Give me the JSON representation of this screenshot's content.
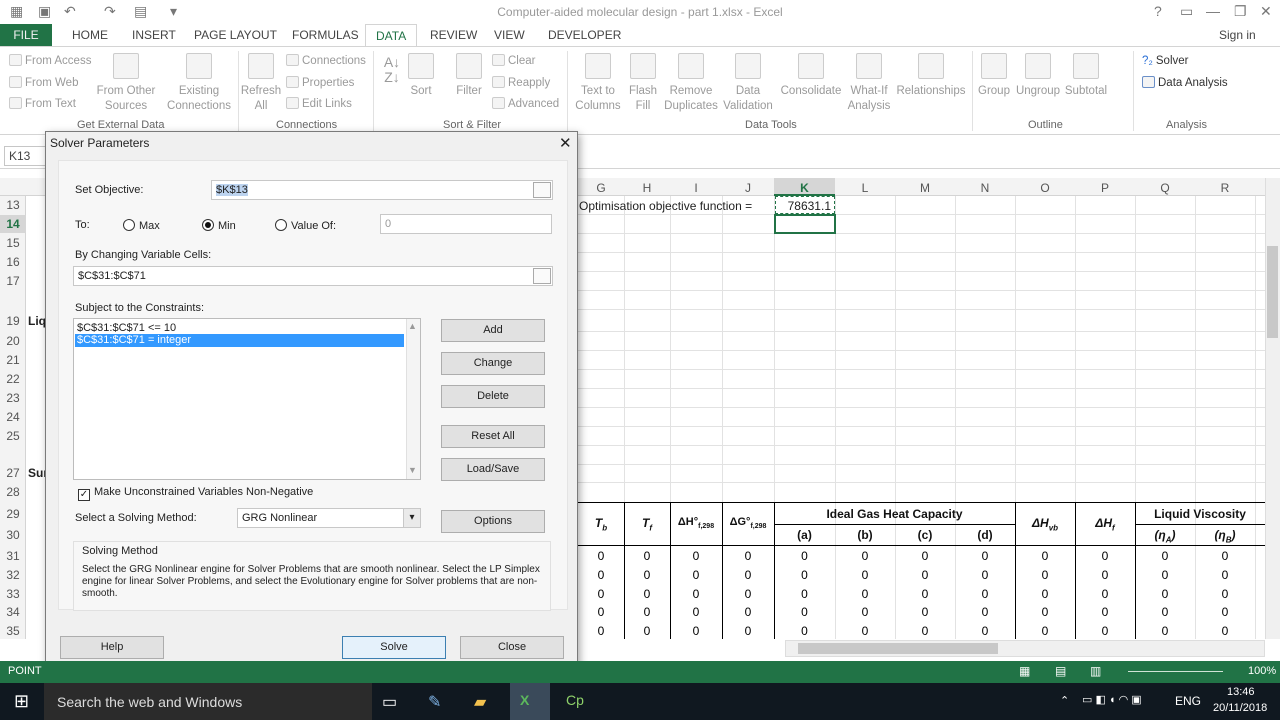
{
  "window": {
    "title": "Computer-aided molecular design - part 1.xlsx - Excel",
    "help": "?",
    "signin": "Sign in"
  },
  "tabs": [
    "FILE",
    "HOME",
    "INSERT",
    "PAGE LAYOUT",
    "FORMULAS",
    "DATA",
    "REVIEW",
    "VIEW",
    "DEVELOPER"
  ],
  "ribbon": {
    "get_external": {
      "from_access": "From Access",
      "from_web": "From Web",
      "from_text": "From Text",
      "from_other1": "From Other",
      "from_other2": "Sources",
      "existing1": "Existing",
      "existing2": "Connections",
      "group": "Get External Data"
    },
    "connections": {
      "refresh1": "Refresh",
      "refresh2": "All",
      "connections": "Connections",
      "properties": "Properties",
      "edit_links": "Edit Links",
      "group": "Connections"
    },
    "sort_filter": {
      "sort": "Sort",
      "filter": "Filter",
      "clear": "Clear",
      "reapply": "Reapply",
      "advanced": "Advanced",
      "group": "Sort & Filter"
    },
    "data_tools": {
      "t2c1": "Text to",
      "t2c2": "Columns",
      "flash1": "Flash",
      "flash2": "Fill",
      "remdup1": "Remove",
      "remdup2": "Duplicates",
      "dv1": "Data",
      "dv2": "Validation",
      "consolidate": "Consolidate",
      "whatif1": "What-If",
      "whatif2": "Analysis",
      "relationships": "Relationships",
      "group": "Data Tools"
    },
    "outline": {
      "group_btn": "Group",
      "ungroup": "Ungroup",
      "subtotal": "Subtotal",
      "group": "Outline"
    },
    "analysis": {
      "solver": "Solver",
      "data_analysis": "Data Analysis",
      "group": "Analysis"
    }
  },
  "namebox": "K13",
  "columns": [
    "G",
    "H",
    "I",
    "J",
    "K",
    "L",
    "M",
    "N",
    "O",
    "P",
    "Q",
    "R"
  ],
  "rows": [
    "13",
    "14",
    "15",
    "16",
    "17",
    "19",
    "20",
    "21",
    "22",
    "23",
    "24",
    "25",
    "27",
    "28",
    "29",
    "30",
    "31",
    "32",
    "33",
    "34",
    "35"
  ],
  "sheet": {
    "label_a19": "Liq",
    "label_a27": "Sur",
    "objective_label": "Optimisation objective function =",
    "objective_value": "78631.1",
    "hdr_tb": "T",
    "hdr_tb_sub": "b",
    "hdr_tf": "T",
    "hdr_tf_sub": "f",
    "hdr_dh": "ΔH°",
    "hdr_dh_sub": "f,298",
    "hdr_dg": "ΔG°",
    "hdr_dg_sub": "f,298",
    "hdr_igc": "Ideal Gas Heat Capacity",
    "hdr_a": "(a)",
    "hdr_b": "(b)",
    "hdr_c": "(c)",
    "hdr_d": "(d)",
    "hdr_dhvb": "ΔH",
    "hdr_dhvb_sub": "vb",
    "hdr_dhf": "ΔH",
    "hdr_dhf_sub": "f",
    "hdr_lv": "Liquid Viscosity",
    "hdr_na": "(η",
    "hdr_na_sub": "A",
    "hdr_na_end": ")",
    "hdr_nb": "(η",
    "hdr_nb_sub": "B",
    "hdr_nb_end": ")",
    "zero": "0"
  },
  "dialog": {
    "title": "Solver Parameters",
    "close": "✕",
    "set_objective_label": "Set Objective:",
    "set_objective_value": "$K$13",
    "to_label": "To:",
    "max_label": "Max",
    "min_label": "Min",
    "valueof_label": "Value Of:",
    "valueof_value": "0",
    "changing_label": "By Changing Variable Cells:",
    "changing_value": "$C$31:$C$71",
    "constraints_label": "Subject to the Constraints:",
    "constraints": [
      "$C$31:$C$71 <= 10",
      "$C$31:$C$71 = integer"
    ],
    "add": "Add",
    "change": "Change",
    "delete": "Delete",
    "reset_all": "Reset All",
    "load_save": "Load/Save",
    "nonneg_label": "Make Unconstrained Variables Non-Negative",
    "method_label": "Select a Solving Method:",
    "method_value": "GRG Nonlinear",
    "options": "Options",
    "solving_method_title": "Solving Method",
    "solving_method_text": "Select the GRG Nonlinear engine for Solver Problems that are smooth nonlinear. Select the LP Simplex engine for linear Solver Problems, and select the Evolutionary engine for Solver problems that are non-smooth.",
    "help": "Help",
    "solve": "Solve",
    "close_btn": "Close"
  },
  "status": {
    "mode": "POINT",
    "zoom": "100%"
  },
  "taskbar": {
    "search": "Search the web and Windows",
    "lang": "ENG",
    "time": "13:46",
    "date": "20/11/2018"
  },
  "colors": {
    "excel_green": "#217346",
    "selection": "#3399ff"
  }
}
